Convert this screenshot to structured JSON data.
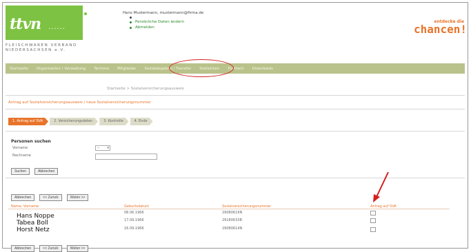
{
  "header": {
    "logo_mark": "ttvn",
    "logo_trail": "......",
    "logo_sub_line1": "FLEISCHWAREN VERBAND",
    "logo_sub_line2": "NIEDERSACHSEN e.V.",
    "user_line": "Hans Mustermann, mustermann@firma.de",
    "user_links": [
      "Persönliche Daten ändern",
      "Abmelden"
    ],
    "slogan_small": "entdecke die",
    "slogan_big": "chancen!"
  },
  "nav": {
    "items": [
      "Startseite",
      "Organisation / Verwaltung",
      "Termine",
      "Mitglieder",
      "Sozialabgaben / Transfer",
      "Statistiken",
      "Postfach",
      "Downloads"
    ]
  },
  "breadcrumb": "Startseite > Sozialversicherungsausweis",
  "sub_title": "Antrag auf Sozialversicherungsausweis / neue Sozialversicherungsnummer",
  "steps": [
    "1. Antrag auf SVA",
    "2. Versicherungsdaten",
    "3. Kontrolle",
    "4. Ende"
  ],
  "search": {
    "title": "Personen suchen",
    "field1_label": "Vorname",
    "select_value": "--",
    "field2_label": "Nachname",
    "search_button": "Suchen",
    "reset_button": "Abbrechen"
  },
  "pager_top": [
    "Abbrechen",
    "<< Zurück",
    "Weiter >>"
  ],
  "table": {
    "headers": [
      "Name, Vorname",
      "Geburtsdatum",
      "Sozialversicherungsnummer",
      "Antrag auf SVA"
    ],
    "rows": [
      {
        "name": "Hans Noppe",
        "birth": "08.06.1966",
        "svnr": "29080619N"
      },
      {
        "name": "Tabea Boll",
        "birth": "17.09.1966",
        "svnr": "29180633B"
      },
      {
        "name": "Horst Netz",
        "birth": "16.09.1966",
        "svnr": "29080614N"
      }
    ]
  },
  "pager_bottom": [
    "Abbrechen",
    "<< Zurück",
    "Weiter >>"
  ],
  "colors": {
    "brand_green": "#7dc242",
    "nav_bar": "#b9c28a",
    "accent_orange": "#e8742a",
    "annotation_red": "#d42020"
  }
}
